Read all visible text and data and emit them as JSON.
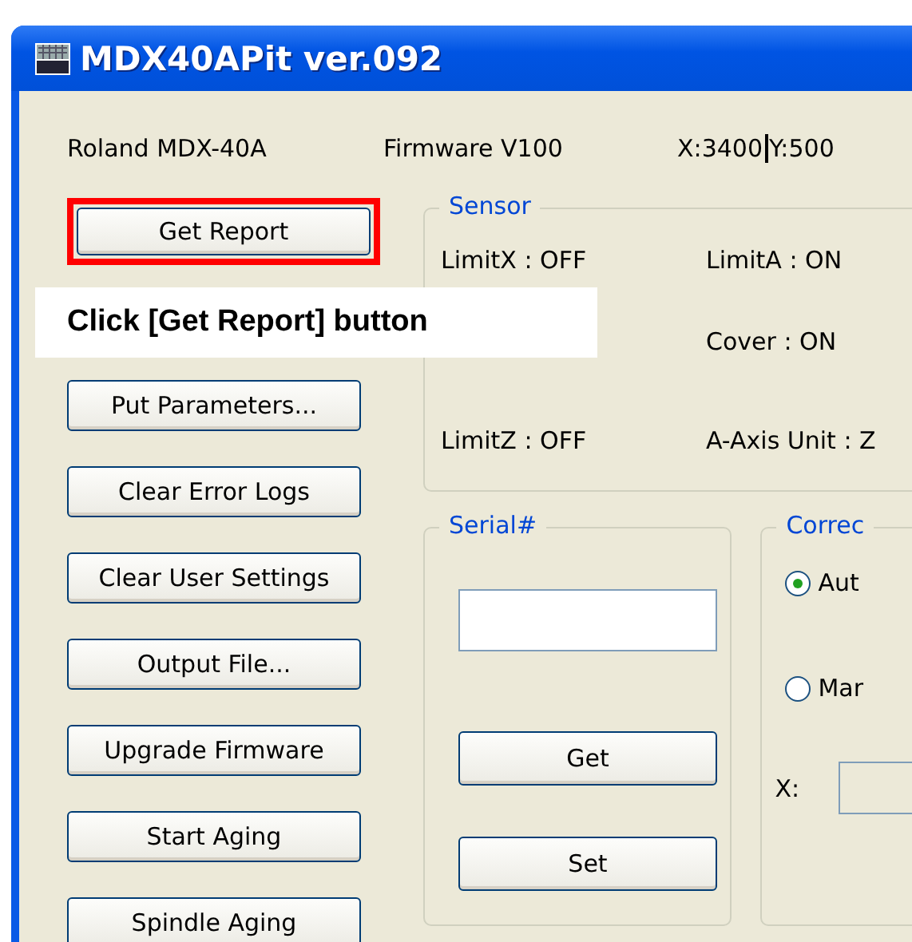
{
  "window": {
    "title": "MDX40APit ver.092"
  },
  "info": {
    "model": "Roland MDX-40A",
    "firmware": "Firmware  V100",
    "x": "X:3400",
    "y": "Y:500"
  },
  "buttons": [
    {
      "label": "Get Report",
      "highlighted": true
    },
    {
      "label": "Put Parameters...",
      "highlighted": false
    },
    {
      "label": "Clear Error Logs",
      "highlighted": false
    },
    {
      "label": "Clear User Settings",
      "highlighted": false
    },
    {
      "label": "Output File...",
      "highlighted": false
    },
    {
      "label": "Upgrade Firmware",
      "highlighted": false
    },
    {
      "label": "Start Aging",
      "highlighted": false
    },
    {
      "label": "Spindle Aging",
      "highlighted": false
    }
  ],
  "callout": {
    "text": "Click [Get Report] button"
  },
  "sensor": {
    "title": "Sensor",
    "rows": [
      {
        "left": "LimitX : OFF",
        "right": "LimitA : ON"
      },
      {
        "right": "Cover : ON"
      },
      {
        "left": "LimitZ : OFF",
        "right": "A-Axis Unit : Z"
      }
    ]
  },
  "serial": {
    "title": "Serial#",
    "buttons": [
      "Get",
      "Set"
    ]
  },
  "correction": {
    "title": "Correc",
    "options": [
      {
        "label": "Aut",
        "selected": true
      },
      {
        "label": "Mar",
        "selected": false
      }
    ],
    "x_label": "X:"
  }
}
